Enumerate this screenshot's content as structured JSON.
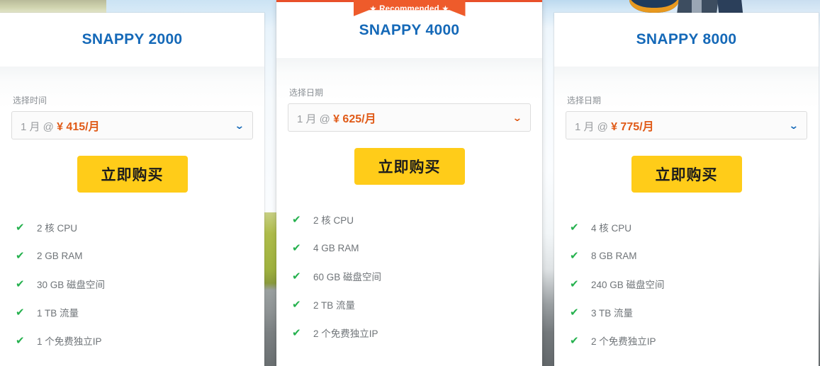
{
  "ribbon": {
    "label": "★ Recommended ★"
  },
  "colors": {
    "title_blue": "#1569b8",
    "accent_orange": "#e8502a",
    "price_orange": "#e05a17",
    "buy_yellow": "#ffcc19",
    "tick_green": "#25b14e"
  },
  "icons": {
    "check": "✔",
    "chevron_down": "⌄",
    "star": "★"
  },
  "plans": [
    {
      "title": "SNAPPY 2000",
      "recommended": false,
      "select_label": "选择时间",
      "select_term": "1 月 @ ",
      "select_price": "¥ 415/月",
      "buy_label": "立即购买",
      "features": [
        "2 核 CPU",
        "2 GB RAM",
        "30 GB 磁盘空间",
        "1 TB 流量",
        "1 个免费独立IP"
      ]
    },
    {
      "title": "SNAPPY 4000",
      "recommended": true,
      "select_label": "选择日期",
      "select_term": "1 月 @ ",
      "select_price": "¥ 625/月",
      "buy_label": "立即购买",
      "features": [
        "2 核 CPU",
        "4 GB RAM",
        "60 GB 磁盘空间",
        "2 TB 流量",
        "2 个免费独立IP"
      ]
    },
    {
      "title": "SNAPPY 8000",
      "recommended": false,
      "select_label": "选择日期",
      "select_term": "1 月 @ ",
      "select_price": "¥ 775/月",
      "buy_label": "立即购买",
      "features": [
        "4 核 CPU",
        "8 GB RAM",
        "240 GB 磁盘空间",
        "3 TB 流量",
        "2 个免费独立IP"
      ]
    }
  ]
}
